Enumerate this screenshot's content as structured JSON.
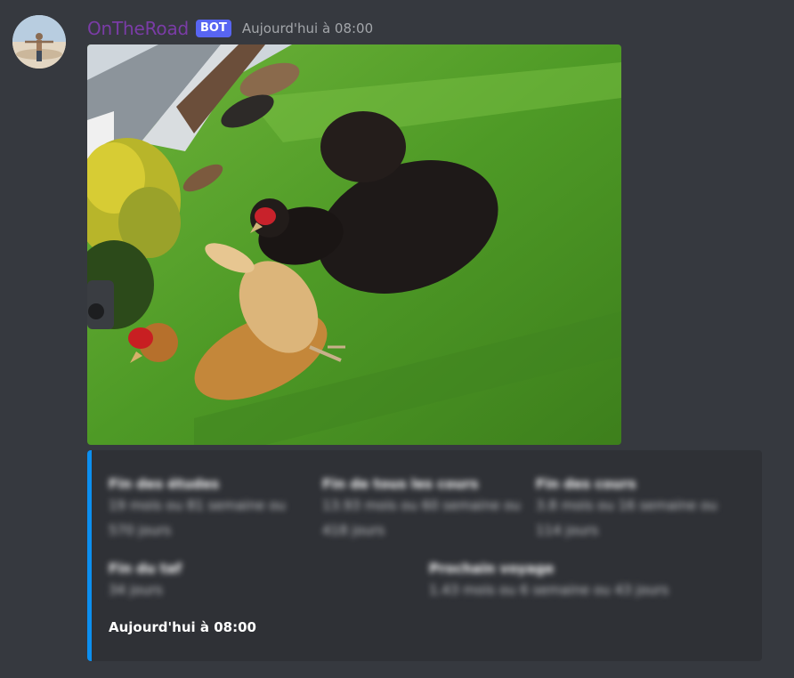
{
  "message": {
    "username": "OnTheRoad",
    "bot_tag": "BOT",
    "timestamp": "Aujourd'hui à 08:00",
    "username_color": "#7a3ca6"
  },
  "attachment": {
    "type": "photo",
    "subject": "chickens-on-lawn"
  },
  "embed": {
    "accent_color": "#0c8ff0",
    "fields": [
      {
        "name": "Fin des études",
        "value": "19 mois ou 81 semaine ou 570 jours"
      },
      {
        "name": "Fin de tous les cours",
        "value": "13.93 mois ou 60 semaine ou 418 jours"
      },
      {
        "name": "Fin des cours",
        "value": "3.8 mois ou 16 semaine ou 114 jours"
      },
      {
        "name": "Fin du taf",
        "value": "34 jours"
      },
      {
        "name": "Prochain voyage",
        "value": "1.43 mois ou 6 semaine ou 43 jours"
      }
    ],
    "footer": "Aujourd'hui à 08:00"
  }
}
